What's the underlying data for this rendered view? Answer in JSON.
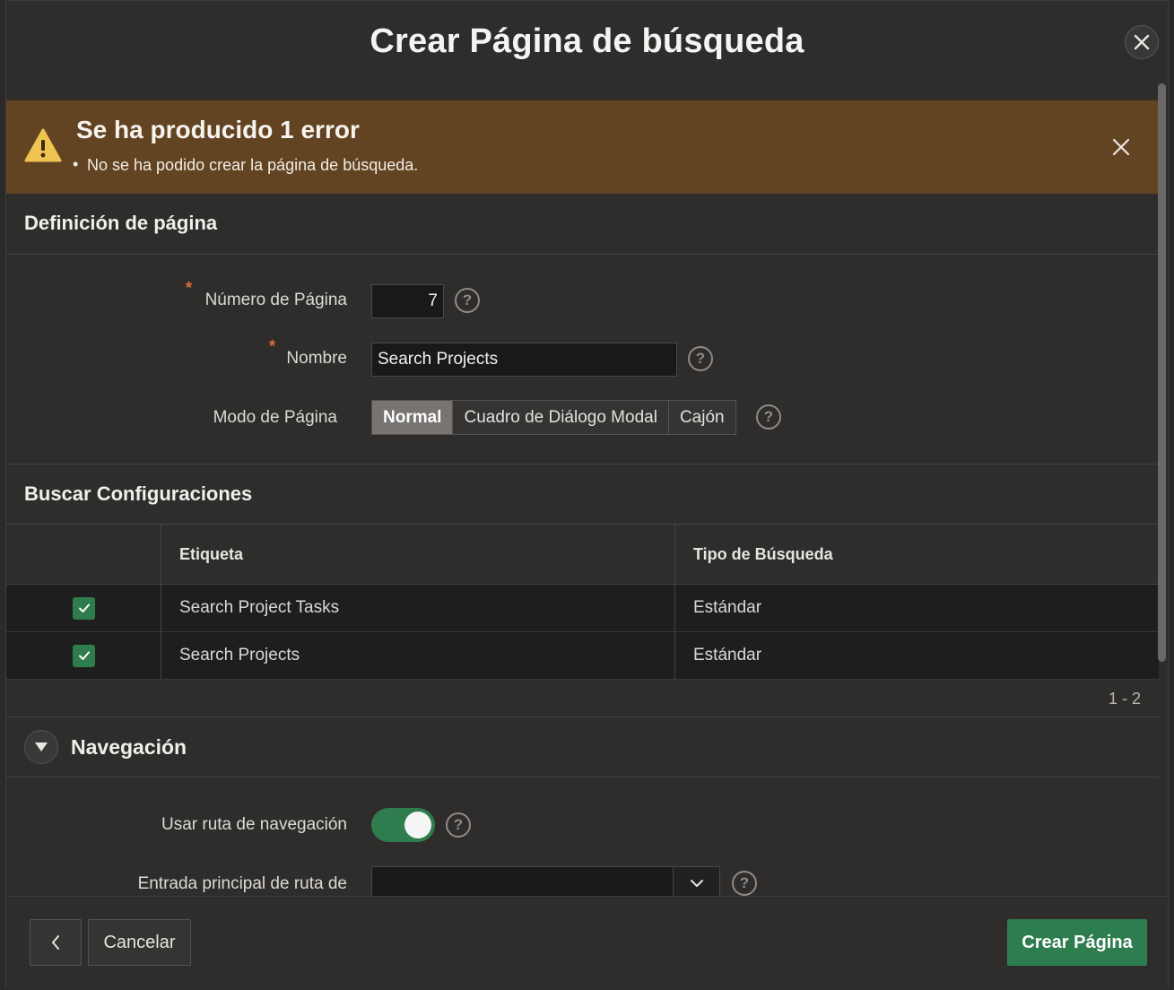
{
  "dialog": {
    "title": "Crear Página de búsqueda",
    "close_icon": "close-icon"
  },
  "alert": {
    "title": "Se ha producido 1 error",
    "message": "No se ha podido crear la página de búsqueda.",
    "icon": "warning-icon",
    "color": "#624422"
  },
  "page_definition": {
    "title": "Definición de página",
    "page_number": {
      "label": "Número de Página",
      "required": "*",
      "value": "7"
    },
    "name": {
      "label": "Nombre",
      "required": "*",
      "value": "Search Projects"
    },
    "page_mode": {
      "label": "Modo de Página",
      "options": [
        "Normal",
        "Cuadro de Diálogo Modal",
        "Cajón"
      ],
      "selected": "Normal"
    },
    "help": "?"
  },
  "search_config": {
    "title": "Buscar Configuraciones",
    "columns": [
      "",
      "Etiqueta",
      "Tipo de Búsqueda"
    ],
    "rows": [
      {
        "checked": true,
        "label": "Search Project Tasks",
        "type": "Estándar"
      },
      {
        "checked": true,
        "label": "Search Projects",
        "type": "Estándar"
      }
    ],
    "pagination": "1 - 2"
  },
  "navigation": {
    "title": "Navegación",
    "use_breadcrumb": {
      "label": "Usar ruta de navegación",
      "on": true
    },
    "breadcrumb_parent": {
      "label": "Entrada principal de ruta de",
      "value": ""
    }
  },
  "footer": {
    "back_icon": "chevron-left-icon",
    "cancel_label": "Cancelar",
    "create_label": "Crear Página"
  },
  "colors": {
    "accent_green": "#2e7d4f",
    "alert_bg": "#624422",
    "required_star": "#e0703a"
  }
}
